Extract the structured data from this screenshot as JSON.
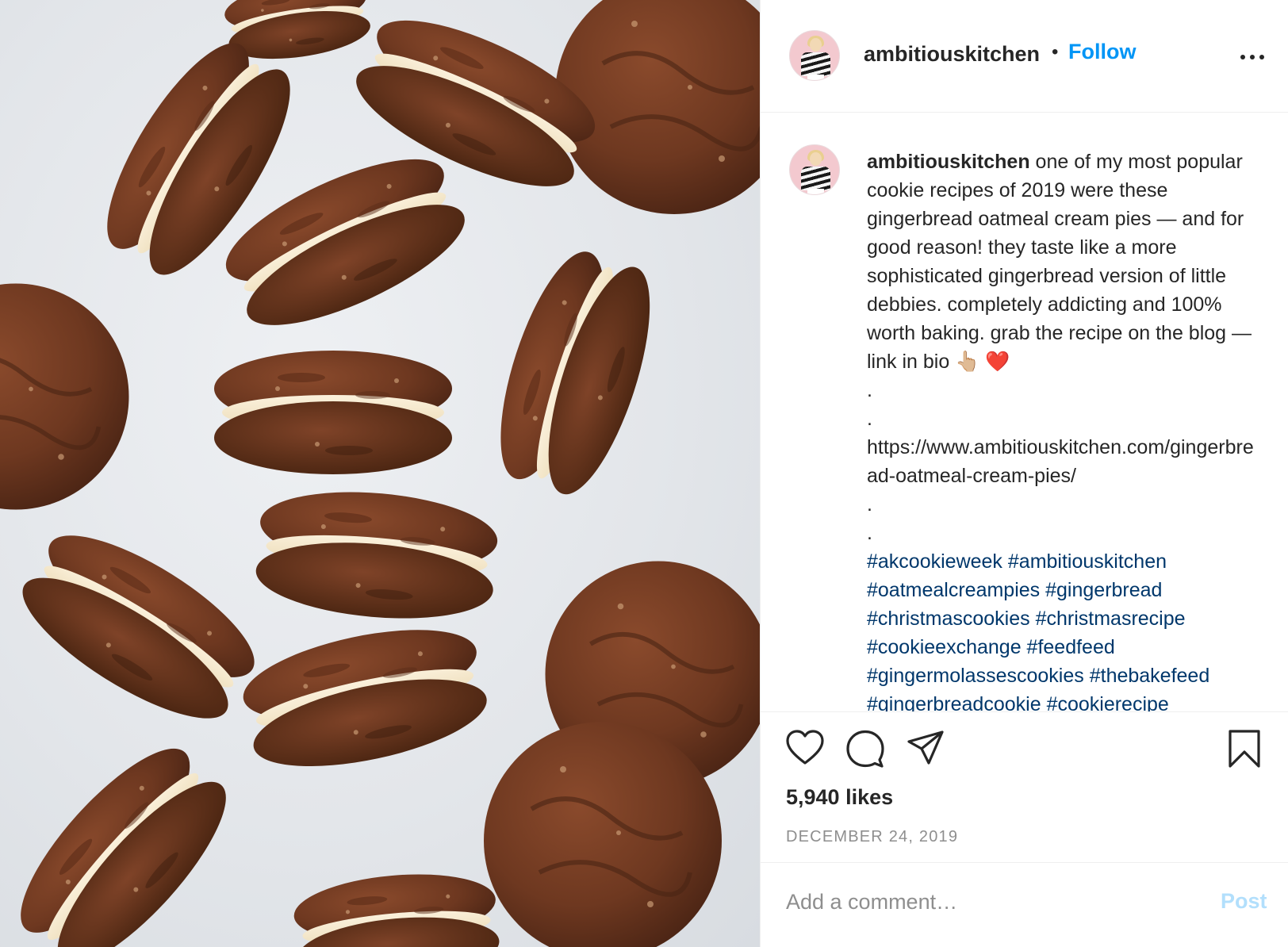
{
  "photo": {
    "alt": "gingerbread oatmeal cream pies"
  },
  "header": {
    "username": "ambitiouskitchen",
    "separator": "•",
    "follow_label": "Follow",
    "more_icon": "more-options-icon"
  },
  "caption": {
    "username": "ambitiouskitchen",
    "text": "one of my most popular cookie recipes of 2019 were these gingerbread oatmeal cream pies — and for good reason! they taste like a more sophisticated gingerbread version of little debbies. completely addicting and 100% worth baking. grab the recipe on the blog — link in bio 👆🏼 ❤️",
    "dot": ".",
    "url": "https://www.ambitiouskitchen.com/gingerbread-oatmeal-cream-pies/",
    "hashtags": [
      "#akcookieweek",
      "#ambitiouskitchen",
      "#oatmealcreampies",
      "#gingerbread",
      "#christmascookies",
      "#christmasrecipe",
      "#cookieexchange",
      "#feedfeed",
      "#gingermolassescookies",
      "#thebakefeed",
      "#gingerbreadcookie",
      "#cookierecipe"
    ]
  },
  "actions": {
    "like_icon": "heart-icon",
    "comment_icon": "comment-icon",
    "share_icon": "share-icon",
    "save_icon": "bookmark-icon"
  },
  "likes": "5,940 likes",
  "date": "DECEMBER 24, 2019",
  "comment": {
    "placeholder": "Add a comment…",
    "post_label": "Post"
  },
  "colors": {
    "link_blue": "#0095f6",
    "hashtag_blue": "#00376b",
    "post_disabled": "#b2dffc",
    "muted": "#8e8e8e",
    "text": "#262626"
  }
}
